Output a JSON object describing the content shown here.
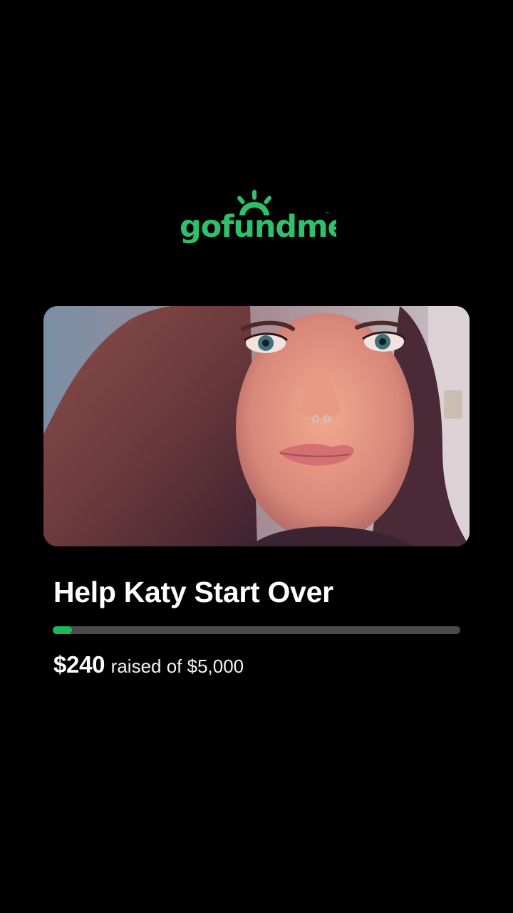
{
  "brand": {
    "logo_text": "gofundme",
    "trademark": "™",
    "color": "#2ec06a"
  },
  "campaign": {
    "photo_alt": "campaign-photo",
    "title": "Help Katy Start Over",
    "raised": "$240",
    "goal_text": "raised of $5,000",
    "progress": 0.048,
    "progress_color": "#1db954",
    "track_color": "#4a4a4a"
  }
}
